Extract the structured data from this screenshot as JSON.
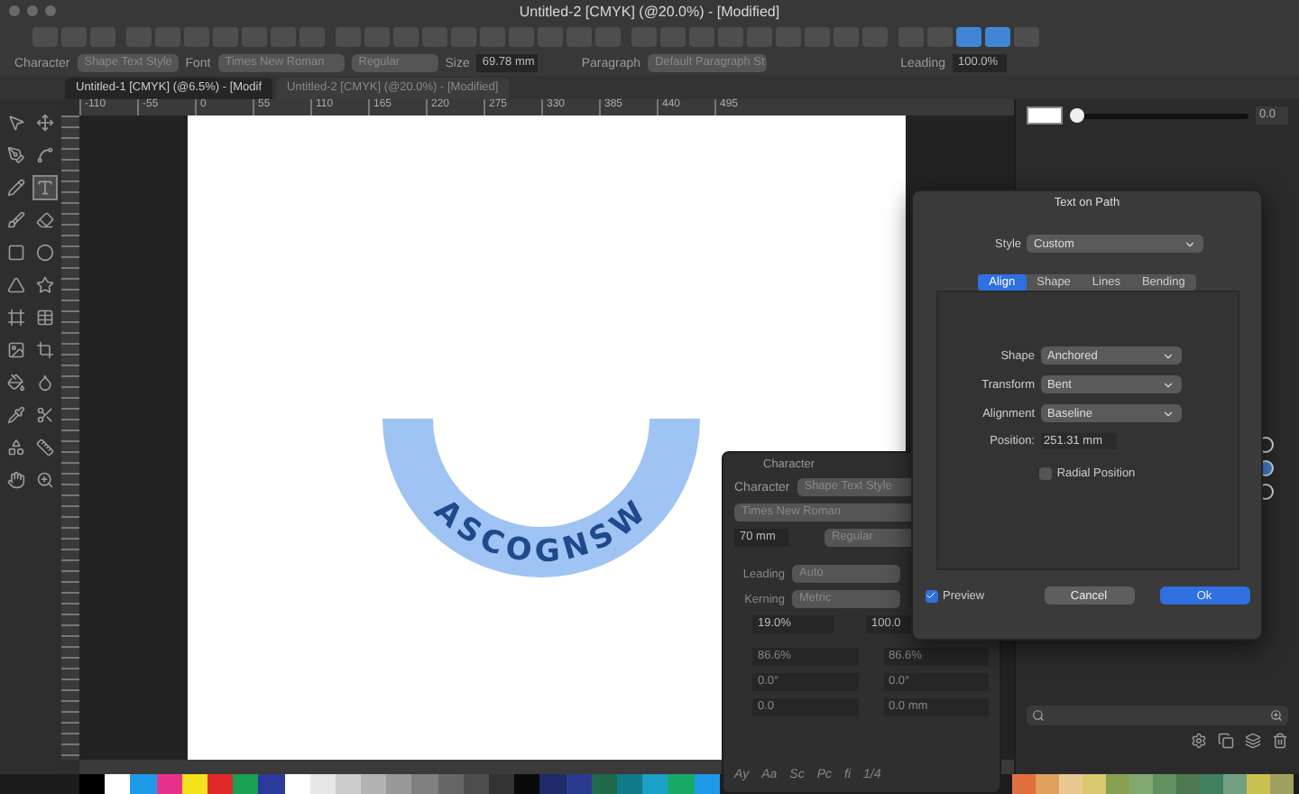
{
  "window": {
    "title": "Untitled-2 [CMYK] (@20.0%) - [Modified]"
  },
  "toolbar": {
    "buttons": [
      {
        "selected": false
      },
      {
        "selected": false
      },
      {
        "selected": false
      },
      {
        "selected": false
      },
      {
        "selected": false
      },
      {
        "selected": false
      },
      {
        "selected": false
      },
      {
        "selected": false
      },
      {
        "selected": false
      },
      {
        "selected": false
      },
      {
        "selected": false
      },
      {
        "selected": false
      },
      {
        "selected": false
      },
      {
        "selected": false
      },
      {
        "selected": false
      },
      {
        "selected": false
      },
      {
        "selected": false
      },
      {
        "selected": false
      },
      {
        "selected": false
      },
      {
        "selected": false
      },
      {
        "selected": false
      },
      {
        "selected": false
      },
      {
        "selected": false
      },
      {
        "selected": false
      },
      {
        "selected": false
      },
      {
        "selected": false
      },
      {
        "selected": false
      },
      {
        "selected": false
      },
      {
        "selected": false
      },
      {
        "selected": false
      },
      {
        "selected": false
      },
      {
        "selected": true
      },
      {
        "selected": true
      },
      {
        "selected": false
      }
    ]
  },
  "context_bar": {
    "character_label": "Character",
    "character_style": "Shape Text Style",
    "font_label": "Font",
    "font": "Times New Roman",
    "weight": "Regular",
    "size_label": "Size",
    "size": "69.78 mm",
    "paragraph_label": "Paragraph",
    "paragraph_style": "Default Paragraph St",
    "leading_label": "Leading",
    "leading": "100.0%"
  },
  "tabs": [
    {
      "label": "Untitled-1 [CMYK] (@6.5%) - [Modif",
      "selected": true
    },
    {
      "label": "Untitled-2 [CMYK] (@20.0%) - [Modified]",
      "selected": false
    }
  ],
  "tools": [
    {
      "selected": false
    },
    {
      "selected": false
    },
    {
      "selected": false
    },
    {
      "selected": false
    },
    {
      "selected": false
    },
    {
      "selected": true
    },
    {
      "selected": false
    },
    {
      "selected": false
    },
    {
      "selected": false
    },
    {
      "selected": false
    },
    {
      "selected": false
    },
    {
      "selected": false
    },
    {
      "selected": false
    },
    {
      "selected": false
    },
    {
      "selected": false
    },
    {
      "selected": false
    },
    {
      "selected": false
    },
    {
      "selected": false
    },
    {
      "selected": false
    },
    {
      "selected": false
    },
    {
      "selected": false
    },
    {
      "selected": false
    },
    {
      "selected": false
    },
    {
      "selected": false
    }
  ],
  "ruler": {
    "labels": [
      "-110",
      "-55",
      "0",
      "55",
      "110",
      "165",
      "220",
      "275",
      "330",
      "385",
      "440",
      "495"
    ]
  },
  "artwork": {
    "text": "ASCOGNSW"
  },
  "right_panel": {
    "opacity": {
      "level": 0.04,
      "reading": "0.0"
    },
    "layers": [
      {
        "selected": false
      },
      {
        "selected": true
      },
      {
        "selected": false
      }
    ]
  },
  "dialog": {
    "title": "Text on Path",
    "style_label": "Style",
    "style": "Custom",
    "tabs": [
      {
        "label": "Align",
        "selected": true
      },
      {
        "label": "Shape",
        "selected": false
      },
      {
        "label": "Lines",
        "selected": false
      },
      {
        "label": "Bending",
        "selected": false
      }
    ],
    "fields": [
      {
        "label": "Shape",
        "value": "Anchored",
        "kind": "select"
      },
      {
        "label": "Transform",
        "value": "Bent",
        "kind": "select"
      },
      {
        "label": "Alignment",
        "value": "Baseline",
        "kind": "select"
      },
      {
        "label": "Position:",
        "value": "251.31 mm",
        "kind": "input"
      }
    ],
    "radial_position": {
      "label": "Radial Position",
      "checked": false
    },
    "preview": {
      "label": "Preview",
      "checked": true
    },
    "buttons": [
      {
        "label": "Cancel",
        "kind": "secondary"
      },
      {
        "label": "Ok",
        "kind": "primary"
      }
    ]
  },
  "character_panel": {
    "title": "Character",
    "style_label": "Character",
    "style": "Shape Text Style",
    "font": "Times New Roman",
    "size": "70 mm",
    "weight": "Regular",
    "rows": [
      {
        "label": "Leading",
        "value": "Auto"
      },
      {
        "label": "Kerning",
        "value": "Metric"
      }
    ],
    "tracking": "19.0%",
    "scale": "100.0",
    "metrics": [
      "86.6%",
      "86.6%",
      "0.0°",
      "0.0°",
      "0.0",
      "0.0 mm"
    ],
    "glyphs": [
      "Ay",
      "Aa",
      "Sc",
      "Pc",
      "fi",
      "1/4"
    ]
  },
  "palette": [
    {
      "color": "#000000"
    },
    {
      "color": "#ffffff"
    },
    {
      "color": "#1e9be8"
    },
    {
      "color": "#e8318a"
    },
    {
      "color": "#f2e31b"
    },
    {
      "color": "#e02a2a"
    },
    {
      "color": "#1aa053"
    },
    {
      "color": "#2b3a9a"
    },
    {
      "color": "#ffffff"
    },
    {
      "color": "#e6e6e6"
    },
    {
      "color": "#cccccc"
    },
    {
      "color": "#b3b3b3"
    },
    {
      "color": "#999999"
    },
    {
      "color": "#808080"
    },
    {
      "color": "#666666"
    },
    {
      "color": "#4d4d4d"
    },
    {
      "color": "#333333"
    },
    {
      "color": "#0a0a0a"
    },
    {
      "color": "#1f2a6b"
    },
    {
      "color": "#2a3b8f"
    },
    {
      "color": "#1e6a4a"
    },
    {
      "color": "#0f7a8a"
    },
    {
      "color": "#1aa0c8"
    },
    {
      "color": "#18a868"
    },
    {
      "color": "#1e9be8"
    },
    {
      "color": "#e07040"
    },
    {
      "color": "#e0a060"
    },
    {
      "color": "#e8c890"
    },
    {
      "color": "#d8c870"
    },
    {
      "color": "#88a050"
    },
    {
      "color": "#80a870"
    },
    {
      "color": "#609060"
    },
    {
      "color": "#507850"
    },
    {
      "color": "#408060"
    },
    {
      "color": "#70a080"
    },
    {
      "color": "#c8c050"
    },
    {
      "color": "#a0a060"
    }
  ]
}
